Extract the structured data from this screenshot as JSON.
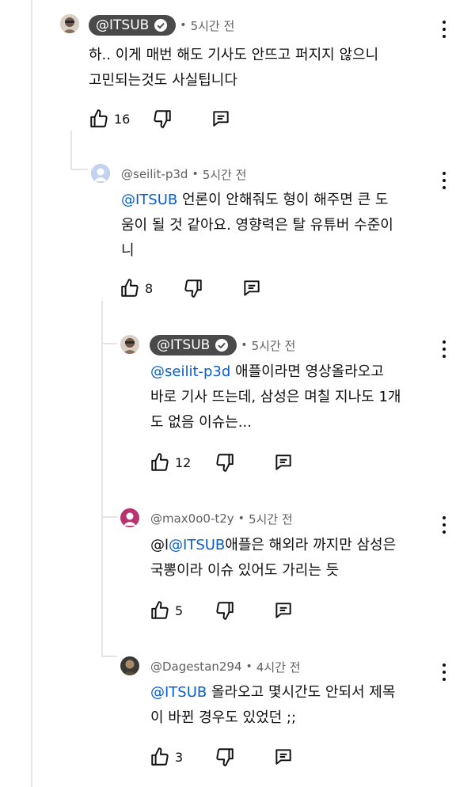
{
  "comments": [
    {
      "author": "@ITSUB",
      "author_style": "verified-badge",
      "time": "5시간 전",
      "separator": "•",
      "lines": [
        "하.. 이게 매번 해도 기사도 안뜨고 퍼지지 않으니",
        "고민되는것도 사실팁니다"
      ],
      "likes": "16",
      "avatar": "photo-avatar"
    },
    {
      "author": "@seilit-p3d",
      "author_style": "plain",
      "time": "5시간 전",
      "separator": "•",
      "mention": "@ITSUB",
      "line1_rest": " 언론이 안해줘도 형이 해주면 큰 도",
      "lines": [
        "움이 될 것 같아요. 영향력은 탈 유튜버 수준이",
        "니"
      ],
      "likes": "8",
      "avatar": "default-avatar-blue"
    },
    {
      "author": "@ITSUB",
      "author_style": "verified-badge",
      "time": "5시간 전",
      "separator": "•",
      "mention": "@seilit-p3d",
      "line1_rest": " 애플이라면 영상올라오고",
      "lines": [
        "바로 기사 뜨는데, 삼성은 며칠 지나도 1개",
        "도 없음 이슈는..."
      ],
      "likes": "12",
      "avatar": "photo-avatar"
    },
    {
      "author": "@max0o0-t2y",
      "author_style": "plain",
      "time": "5시간 전",
      "separator": "•",
      "prefix": "@l",
      "mention": "@ITSUB",
      "line1_rest": "애플은 해외라 까지만 삼성은",
      "lines": [
        "국뽕이라 이슈 있어도 가리는 듯"
      ],
      "likes": "5",
      "avatar": "default-avatar-magenta"
    },
    {
      "author": "@Dagestan294",
      "author_style": "plain",
      "time": "4시간 전",
      "separator": "•",
      "mention": "@ITSUB",
      "line1_rest": " 올라오고 몇시간도 안되서 제목",
      "lines": [
        "이 바뀐 경우도 있었던 ;;"
      ],
      "likes": "3",
      "avatar": "photo-avatar-dark"
    }
  ],
  "icons": {
    "like": "thumbs-up-icon",
    "dislike": "thumbs-down-icon",
    "reply": "reply-icon",
    "more": "more-vert-icon",
    "verified": "verified-check-icon"
  },
  "colors": {
    "mention": "#065fd4",
    "badge": "#4a4a4a",
    "meta": "#606060"
  }
}
